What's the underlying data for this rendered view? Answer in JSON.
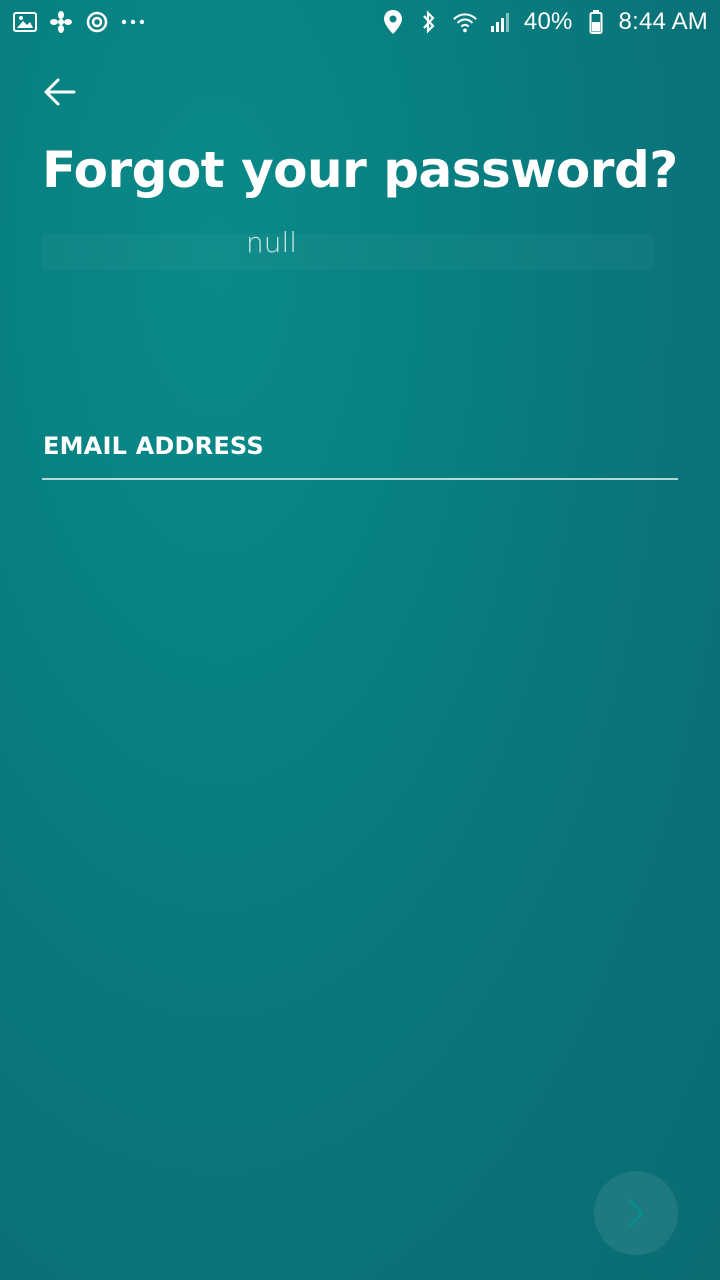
{
  "status_bar": {
    "battery_percent": "40%",
    "time": "8:44 AM",
    "left_icons": [
      "gallery-icon",
      "fan-icon",
      "sync-icon",
      "more-icon"
    ],
    "right_icons": [
      "location-icon",
      "bluetooth-icon",
      "wifi-icon",
      "signal-icon",
      "battery-icon"
    ]
  },
  "header": {
    "title": "Forgot your password?",
    "subtitle": "null"
  },
  "form": {
    "email_label": "EMAIL ADDRESS",
    "email_value": ""
  },
  "colors": {
    "background": "#087f81",
    "text": "#ffffff"
  }
}
